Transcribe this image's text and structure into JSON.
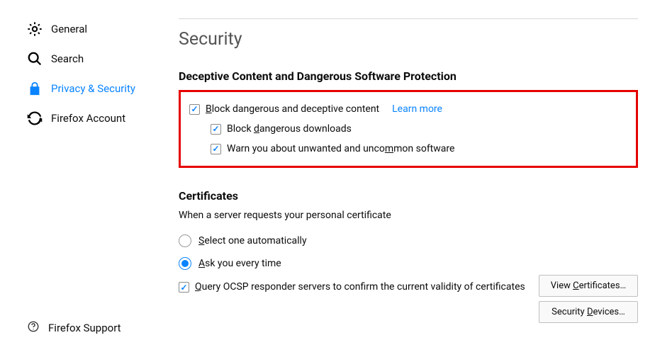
{
  "sidebar": {
    "items": [
      {
        "label": "General"
      },
      {
        "label": "Search"
      },
      {
        "label": "Privacy & Security"
      },
      {
        "label": "Firefox Account"
      }
    ],
    "support": "Firefox Support"
  },
  "main": {
    "heading": "Security",
    "deceptive": {
      "title": "Deceptive Content and Dangerous Software Protection",
      "block_pre": "B",
      "block_post": "lock dangerous and deceptive content",
      "learn_more": "Learn more",
      "downloads_pre": "Block ",
      "downloads_u": "d",
      "downloads_post": "angerous downloads",
      "warn_pre": "Warn you about unwanted and unco",
      "warn_u": "m",
      "warn_post": "mon software"
    },
    "certs": {
      "title": "Certificates",
      "desc": "When a server requests your personal certificate",
      "select_u": "S",
      "select_post": "elect one automatically",
      "ask_u": "A",
      "ask_post": "sk you every time",
      "ocsp_u": "Q",
      "ocsp_post": "uery OCSP responder servers to confirm the current validity of certificates",
      "view_pre": "View ",
      "view_u": "C",
      "view_post": "ertificates…",
      "devices_pre": "Security ",
      "devices_u": "D",
      "devices_post": "evices…"
    }
  }
}
